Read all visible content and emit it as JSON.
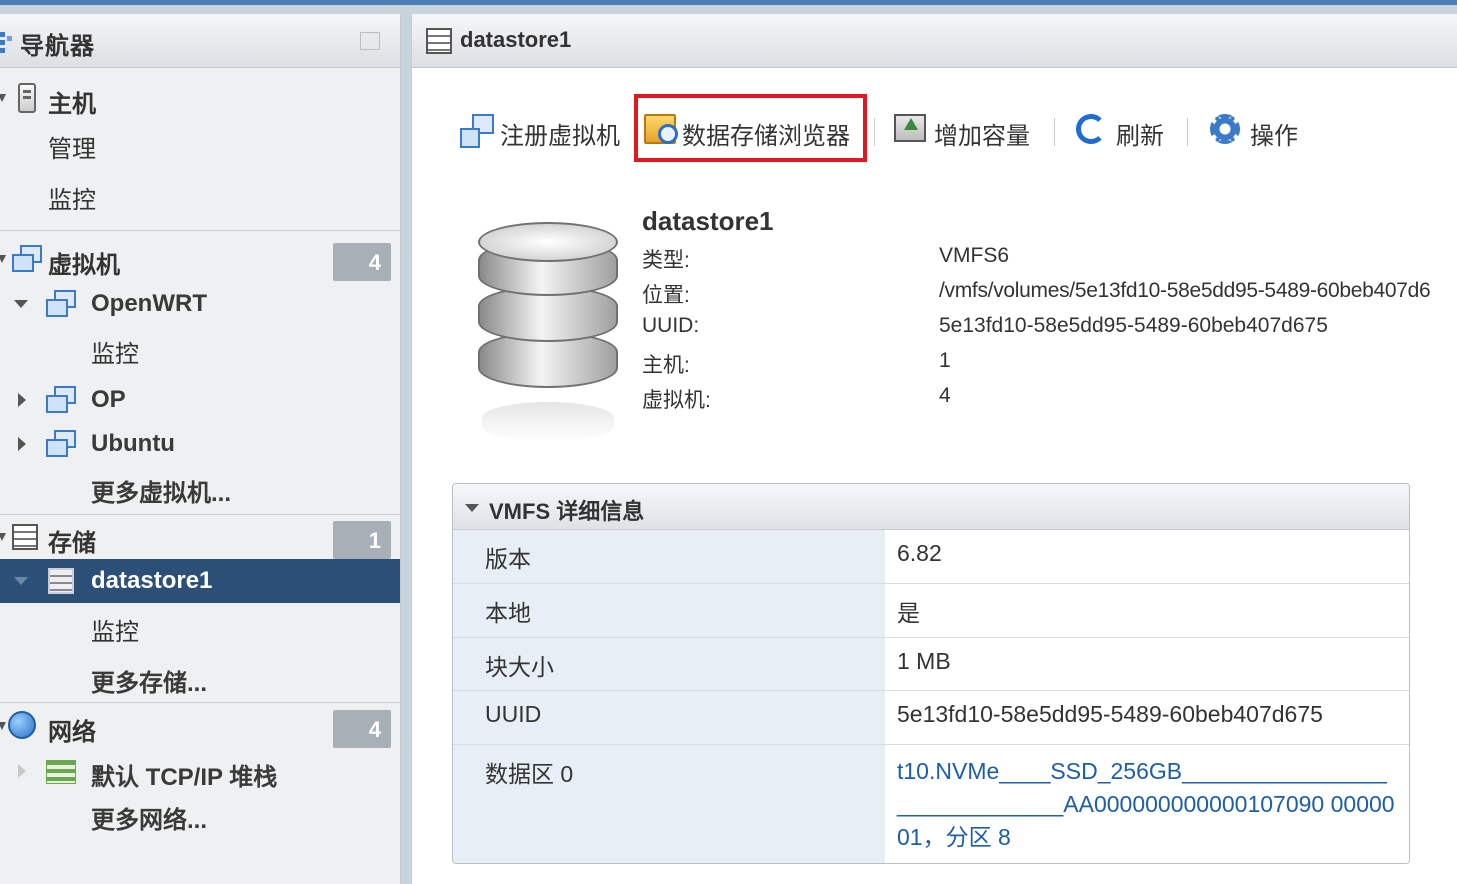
{
  "navigator": {
    "title": "导航器",
    "host": {
      "label": "主机",
      "children": [
        "管理",
        "监控"
      ]
    },
    "vms": {
      "label": "虚拟机",
      "count": "4",
      "items": [
        {
          "label": "OpenWRT",
          "child": "监控"
        },
        {
          "label": "OP"
        },
        {
          "label": "Ubuntu"
        }
      ],
      "more": "更多虚拟机..."
    },
    "storage": {
      "label": "存储",
      "count": "1",
      "selected": "datastore1",
      "child": "监控",
      "more": "更多存储..."
    },
    "network": {
      "label": "网络",
      "count": "4",
      "item": "默认 TCP/IP 堆栈",
      "more": "更多网络..."
    }
  },
  "main": {
    "title": "datastore1",
    "toolbar": {
      "register": "注册虚拟机",
      "browser": "数据存储浏览器",
      "increase": "增加容量",
      "refresh": "刷新",
      "actions": "操作"
    },
    "summary": {
      "name": "datastore1",
      "rows": [
        {
          "key": "类型:",
          "value": "VMFS6"
        },
        {
          "key": "位置:",
          "value": "/vmfs/volumes/5e13fd10-58e5dd95-5489-60beb407d6"
        },
        {
          "key": "UUID:",
          "value": "5e13fd10-58e5dd95-5489-60beb407d675"
        },
        {
          "key": "主机:",
          "value": "1"
        },
        {
          "key": "虚拟机:",
          "value": "4"
        }
      ]
    },
    "details": {
      "title": "VMFS 详细信息",
      "rows": [
        {
          "key": "版本",
          "value": "6.82"
        },
        {
          "key": "本地",
          "value": "是"
        },
        {
          "key": "块大小",
          "value": "1 MB"
        },
        {
          "key": "UUID",
          "value": "5e13fd10-58e5dd95-5489-60beb407d675"
        },
        {
          "key": "数据区 0",
          "value": "t10.NVMe____SSD_256GB_____________________________AA000000000000107090 0000001，分区 8"
        }
      ]
    }
  },
  "colors": {
    "selection": "#2b4f77",
    "highlight_border": "#e0191e",
    "link": "#1c5ea8",
    "badge": "#a9afb6"
  },
  "icons": [
    "host-icon",
    "vm-icon",
    "storage-icon",
    "network-globe-icon",
    "network-stack-icon",
    "register-vm-icon",
    "datastore-browser-icon",
    "increase-capacity-icon",
    "refresh-icon",
    "gear-icon",
    "datastore-large-icon"
  ]
}
